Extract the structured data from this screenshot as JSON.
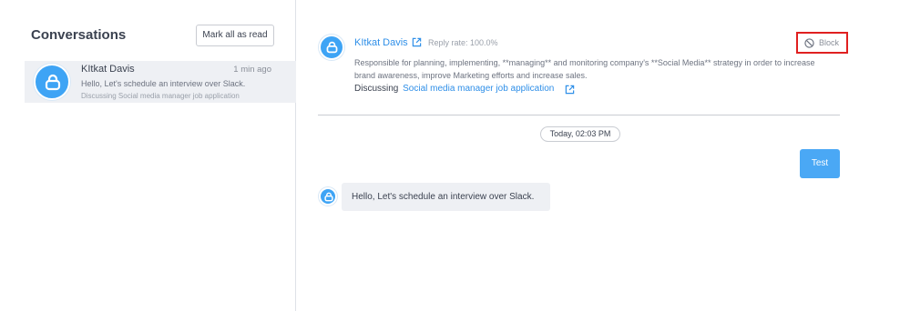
{
  "sidebar": {
    "title": "Conversations",
    "mark_all_label": "Mark all as read",
    "conversations": [
      {
        "name": "KItkat Davis",
        "time": "1 min ago",
        "preview": "Hello, Let's schedule an interview over Slack.",
        "subtitle": "Discussing Social media manager job application",
        "icon": "user-icon"
      }
    ]
  },
  "header": {
    "name": "KItkat Davis",
    "reply_rate": "Reply rate: 100.0%",
    "block_label": "Block",
    "description": "Responsible for planning, implementing, **managing** and monitoring company's **Social Media** strategy in order to increase brand awareness, improve Marketing efforts and increase sales.",
    "discussing_label": "Discussing",
    "discussing_link": "Social media manager job application"
  },
  "messages": {
    "date_separator": "Today, 02:03 PM",
    "items": [
      {
        "direction": "sent",
        "text": "Test"
      },
      {
        "direction": "received",
        "text": "Hello, Let's schedule an interview over Slack."
      }
    ]
  },
  "colors": {
    "accent": "#2f8fe8",
    "avatar": "#3ea4f5",
    "sent_bubble": "#4aa8f5",
    "highlight_border": "#e02020",
    "selected_row": "#eef0f4"
  }
}
